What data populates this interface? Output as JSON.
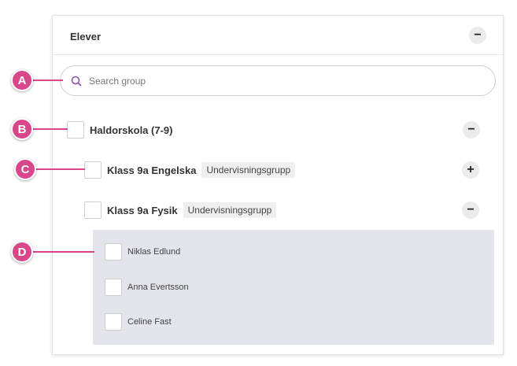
{
  "panel": {
    "title": "Elever",
    "collapse_icon": "minus-icon"
  },
  "search": {
    "placeholder": "Search group",
    "value": "",
    "icon": "search-icon"
  },
  "tree": {
    "school": {
      "label": "Haldorskola (7-9)",
      "toggle": "−",
      "expanded": true
    },
    "groups": [
      {
        "label": "Klass 9a Engelska",
        "tag": "Undervisningsgrupp",
        "toggle": "+",
        "expanded": false
      },
      {
        "label": "Klass 9a Fysik",
        "tag": "Undervisningsgrupp",
        "toggle": "−",
        "expanded": true
      }
    ],
    "members": [
      "Niklas Edlund",
      "Anna Evertsson",
      "Celine Fast"
    ]
  },
  "callouts": [
    "A",
    "B",
    "C",
    "D"
  ],
  "colors": {
    "accent": "#d9468a",
    "search_icon": "#8e44ad",
    "members_bg": "#e4e5ea"
  }
}
